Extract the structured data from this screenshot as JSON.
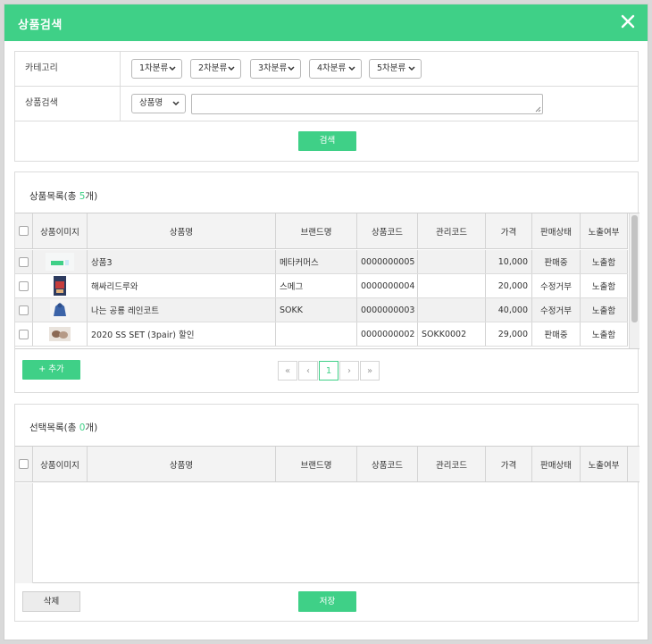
{
  "modal": {
    "title": "상품검색"
  },
  "search": {
    "category_label": "카테고리",
    "category_selects": [
      "1차분류",
      "2차분류",
      "3차분류",
      "4차분류",
      "5차분류"
    ],
    "product_search_label": "상품검색",
    "search_type_value": "상품명",
    "search_button": "검색"
  },
  "product_list": {
    "title_prefix": "상품목록(총 ",
    "count": "5",
    "title_suffix": "개)",
    "columns": [
      "상품이미지",
      "상품명",
      "브랜드명",
      "상품코드",
      "관리코드",
      "가격",
      "판매상태",
      "노출여부"
    ],
    "rows": [
      {
        "name": "상품3",
        "brand": "메타커머스",
        "code": "0000000005",
        "mgmt": "",
        "price": "10,000",
        "status": "판매중",
        "display": "노출함"
      },
      {
        "name": "해싸리드루와",
        "brand": "스메그",
        "code": "0000000004",
        "mgmt": "",
        "price": "20,000",
        "status": "수정거부",
        "display": "노출함"
      },
      {
        "name": "나는 공룡 레인코트",
        "brand": "SOKK",
        "code": "0000000003",
        "mgmt": "",
        "price": "40,000",
        "status": "수정거부",
        "display": "노출함"
      },
      {
        "name": "2020 SS SET (3pair) 할인",
        "brand": "",
        "code": "0000000002",
        "mgmt": "SOKK0002",
        "price": "29,000",
        "status": "판매중",
        "display": "노출함"
      }
    ],
    "add_button": "+ 추가",
    "pager": {
      "first": "«",
      "prev": "‹",
      "current": "1",
      "next": "›",
      "last": "»"
    }
  },
  "selected_list": {
    "title_prefix": "선택목록(총 ",
    "count": "0",
    "title_suffix": "개)",
    "columns": [
      "상품이미지",
      "상품명",
      "브랜드명",
      "상품코드",
      "관리코드",
      "가격",
      "판매상태",
      "노출여부"
    ],
    "delete_button": "삭제",
    "save_button": "저장"
  },
  "colors": {
    "accent": "#3fd087"
  }
}
